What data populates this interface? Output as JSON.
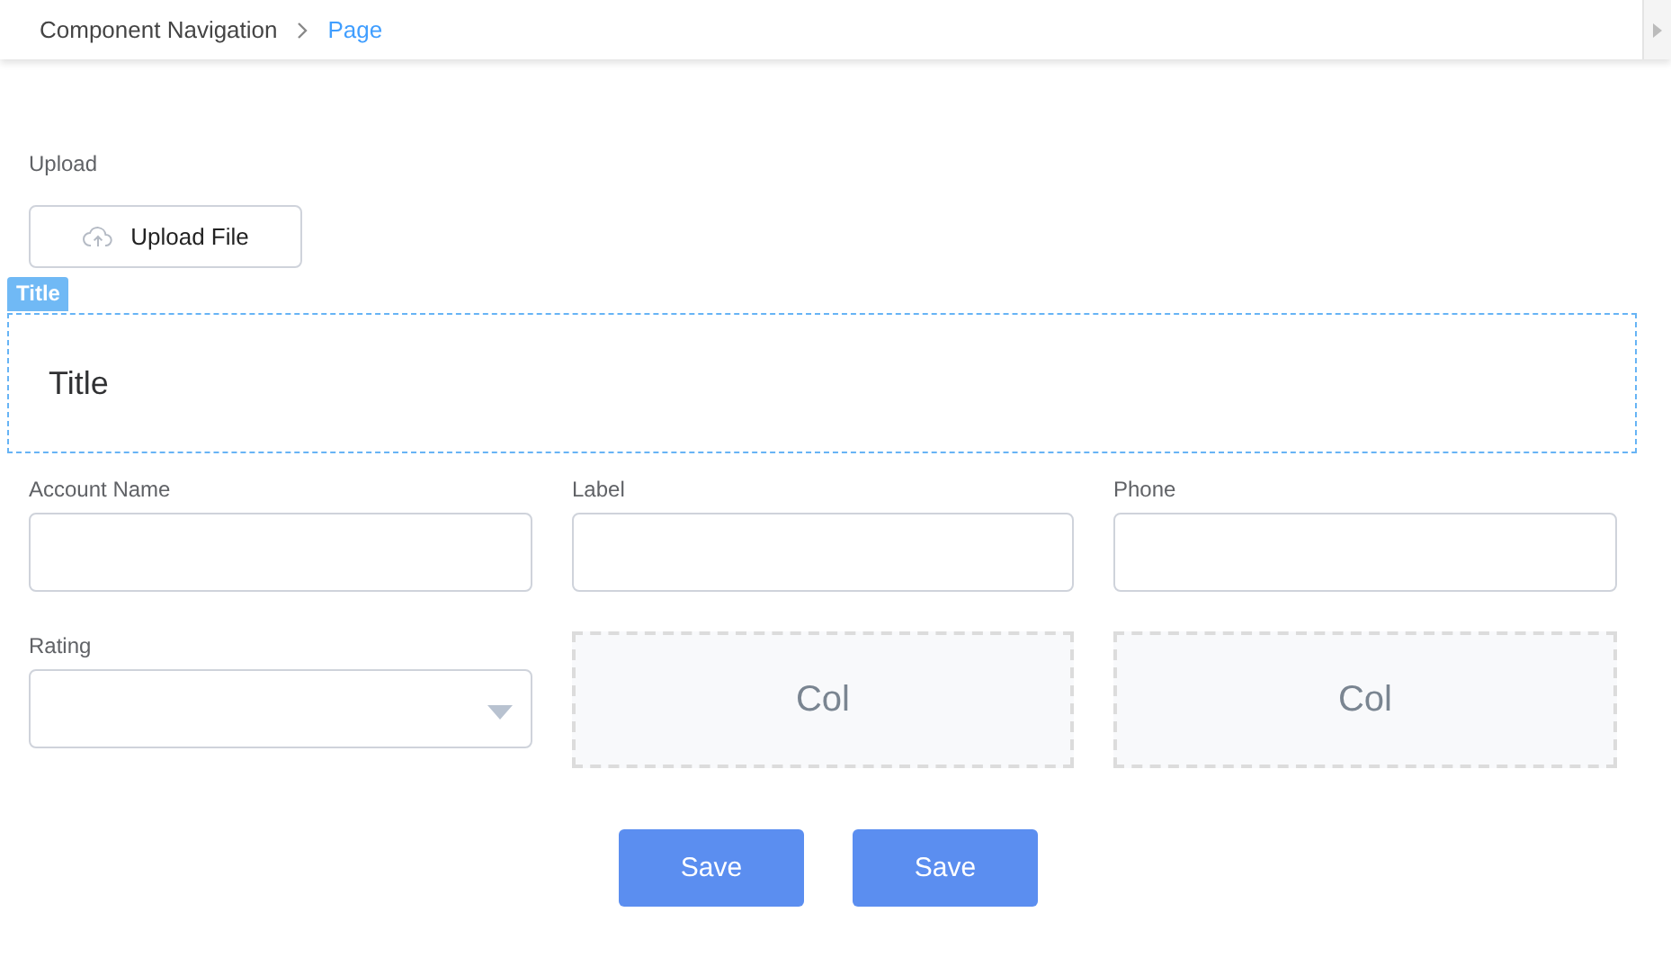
{
  "breadcrumb": [
    {
      "label": "Component Navigation",
      "selected": false
    },
    {
      "label": "Page",
      "selected": true
    }
  ],
  "upload": {
    "label": "Upload",
    "button": "Upload File"
  },
  "title_block": {
    "tag": "Title",
    "text": "Title"
  },
  "fields": [
    {
      "kind": "input",
      "label": "Account Name"
    },
    {
      "kind": "input",
      "label": "Label"
    },
    {
      "kind": "input",
      "label": "Phone"
    },
    {
      "kind": "select",
      "label": "Rating"
    },
    {
      "kind": "placeholder",
      "text": "Col"
    },
    {
      "kind": "placeholder",
      "text": "Col"
    }
  ],
  "buttons": [
    "Save",
    "Save"
  ]
}
